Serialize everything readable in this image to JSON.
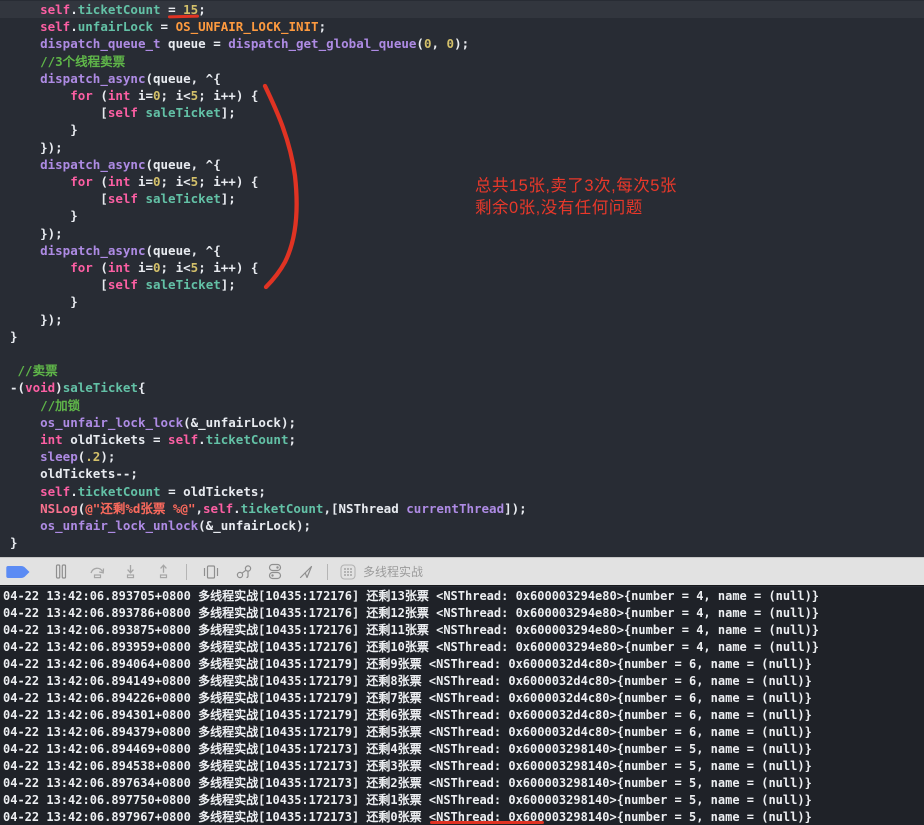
{
  "editor": {
    "background": "#282c34",
    "highlight_line": 0,
    "lines": [
      {
        "hl": true,
        "tokens": [
          [
            "p",
            "    "
          ],
          [
            "k",
            "self"
          ],
          [
            "p",
            "."
          ],
          [
            "t",
            "ticketCount"
          ],
          [
            "p",
            " = "
          ],
          [
            "n",
            "15"
          ],
          [
            "p",
            ";"
          ]
        ]
      },
      {
        "tokens": [
          [
            "p",
            "    "
          ],
          [
            "k",
            "self"
          ],
          [
            "p",
            "."
          ],
          [
            "t",
            "unfairLock"
          ],
          [
            "p",
            " = "
          ],
          [
            "m",
            "OS_UNFAIR_LOCK_INIT"
          ],
          [
            "p",
            ";"
          ]
        ]
      },
      {
        "tokens": [
          [
            "p",
            "    "
          ],
          [
            "f",
            "dispatch_queue_t"
          ],
          [
            "p",
            " queue = "
          ],
          [
            "f",
            "dispatch_get_global_queue"
          ],
          [
            "p",
            "("
          ],
          [
            "n",
            "0"
          ],
          [
            "p",
            ", "
          ],
          [
            "n",
            "0"
          ],
          [
            "p",
            ");"
          ]
        ]
      },
      {
        "tokens": [
          [
            "p",
            "    "
          ],
          [
            "c",
            "//3个线程卖票"
          ]
        ]
      },
      {
        "tokens": [
          [
            "p",
            "    "
          ],
          [
            "f",
            "dispatch_async"
          ],
          [
            "p",
            "(queue, ^{"
          ]
        ]
      },
      {
        "tokens": [
          [
            "p",
            "        "
          ],
          [
            "k",
            "for"
          ],
          [
            "p",
            " ("
          ],
          [
            "k",
            "int"
          ],
          [
            "p",
            " i="
          ],
          [
            "n",
            "0"
          ],
          [
            "p",
            "; i<"
          ],
          [
            "n",
            "5"
          ],
          [
            "p",
            "; i++) {"
          ]
        ]
      },
      {
        "tokens": [
          [
            "p",
            "            ["
          ],
          [
            "k",
            "self"
          ],
          [
            "p",
            " "
          ],
          [
            "t",
            "saleTicket"
          ],
          [
            "p",
            "];"
          ]
        ]
      },
      {
        "tokens": [
          [
            "p",
            "        }"
          ]
        ]
      },
      {
        "tokens": [
          [
            "p",
            "    });"
          ]
        ]
      },
      {
        "tokens": [
          [
            "p",
            "    "
          ],
          [
            "f",
            "dispatch_async"
          ],
          [
            "p",
            "(queue, ^{"
          ]
        ]
      },
      {
        "tokens": [
          [
            "p",
            "        "
          ],
          [
            "k",
            "for"
          ],
          [
            "p",
            " ("
          ],
          [
            "k",
            "int"
          ],
          [
            "p",
            " i="
          ],
          [
            "n",
            "0"
          ],
          [
            "p",
            "; i<"
          ],
          [
            "n",
            "5"
          ],
          [
            "p",
            "; i++) {"
          ]
        ]
      },
      {
        "tokens": [
          [
            "p",
            "            ["
          ],
          [
            "k",
            "self"
          ],
          [
            "p",
            " "
          ],
          [
            "t",
            "saleTicket"
          ],
          [
            "p",
            "];"
          ]
        ]
      },
      {
        "tokens": [
          [
            "p",
            "        }"
          ]
        ]
      },
      {
        "tokens": [
          [
            "p",
            "    });"
          ]
        ]
      },
      {
        "tokens": [
          [
            "p",
            "    "
          ],
          [
            "f",
            "dispatch_async"
          ],
          [
            "p",
            "(queue, ^{"
          ]
        ]
      },
      {
        "tokens": [
          [
            "p",
            "        "
          ],
          [
            "k",
            "for"
          ],
          [
            "p",
            " ("
          ],
          [
            "k",
            "int"
          ],
          [
            "p",
            " i="
          ],
          [
            "n",
            "0"
          ],
          [
            "p",
            "; i<"
          ],
          [
            "n",
            "5"
          ],
          [
            "p",
            "; i++) {"
          ]
        ]
      },
      {
        "tokens": [
          [
            "p",
            "            ["
          ],
          [
            "k",
            "self"
          ],
          [
            "p",
            " "
          ],
          [
            "t",
            "saleTicket"
          ],
          [
            "p",
            "];"
          ]
        ]
      },
      {
        "tokens": [
          [
            "p",
            "        }"
          ]
        ]
      },
      {
        "tokens": [
          [
            "p",
            "    });"
          ]
        ]
      },
      {
        "tokens": [
          [
            "p",
            "}"
          ]
        ]
      },
      {
        "tokens": []
      },
      {
        "tokens": [
          [
            "p",
            " "
          ],
          [
            "c",
            "//卖票"
          ]
        ]
      },
      {
        "tokens": [
          [
            "p",
            "-("
          ],
          [
            "k",
            "void"
          ],
          [
            "p",
            ")"
          ],
          [
            "t",
            "saleTicket"
          ],
          [
            "p",
            "{"
          ]
        ]
      },
      {
        "tokens": [
          [
            "p",
            "    "
          ],
          [
            "c",
            "//加锁"
          ]
        ]
      },
      {
        "tokens": [
          [
            "p",
            "    "
          ],
          [
            "f",
            "os_unfair_lock_lock"
          ],
          [
            "p",
            "(&_unfairLock);"
          ]
        ]
      },
      {
        "tokens": [
          [
            "p",
            "    "
          ],
          [
            "k",
            "int"
          ],
          [
            "p",
            " oldTickets = "
          ],
          [
            "k",
            "self"
          ],
          [
            "p",
            "."
          ],
          [
            "t",
            "ticketCount"
          ],
          [
            "p",
            ";"
          ]
        ]
      },
      {
        "tokens": [
          [
            "p",
            "    "
          ],
          [
            "f",
            "sleep"
          ],
          [
            "p",
            "("
          ],
          [
            "n",
            ".2"
          ],
          [
            "p",
            ");"
          ]
        ]
      },
      {
        "tokens": [
          [
            "p",
            "    oldTickets--;"
          ]
        ]
      },
      {
        "tokens": [
          [
            "p",
            "    "
          ],
          [
            "k",
            "self"
          ],
          [
            "p",
            "."
          ],
          [
            "t",
            "ticketCount"
          ],
          [
            "p",
            " = oldTickets;"
          ]
        ]
      },
      {
        "tokens": [
          [
            "p",
            "    "
          ],
          [
            "g",
            "NSLog"
          ],
          [
            "p",
            "("
          ],
          [
            "s",
            "@\"还剩%d张票 %@\""
          ],
          [
            "p",
            ","
          ],
          [
            "k",
            "self"
          ],
          [
            "p",
            "."
          ],
          [
            "t",
            "ticketCount"
          ],
          [
            "p",
            ",[NSThread "
          ],
          [
            "f",
            "currentThread"
          ],
          [
            "p",
            "]);"
          ]
        ]
      },
      {
        "tokens": [
          [
            "p",
            "    "
          ],
          [
            "f",
            "os_unfair_lock_unlock"
          ],
          [
            "p",
            "(&_unfairLock);"
          ]
        ]
      },
      {
        "tokens": [
          [
            "p",
            "}"
          ]
        ]
      }
    ]
  },
  "annotation": {
    "line1": "总共15张,卖了3次,每次5张",
    "line2": "剩余0张,没有任何问题",
    "color": "#e8382a",
    "underlined_code_value": "15",
    "underlined_console_text": "还剩0张票"
  },
  "debug_bar": {
    "scheme_label": "多线程实战",
    "accent_blue": "#5b8bf4",
    "icon_names": [
      "breakpoint-arrow",
      "pause",
      "step-over",
      "step-into",
      "step-out",
      "view-debugger",
      "memory-graph",
      "environment-overrides",
      "simulate-location",
      "app-grid"
    ]
  },
  "console": {
    "background": "#1f2228",
    "lines": [
      "04-22 13:42:06.893705+0800 多线程实战[10435:172176] 还剩13张票 <NSThread: 0x600003294e80>{number = 4, name = (null)}",
      "04-22 13:42:06.893786+0800 多线程实战[10435:172176] 还剩12张票 <NSThread: 0x600003294e80>{number = 4, name = (null)}",
      "04-22 13:42:06.893875+0800 多线程实战[10435:172176] 还剩11张票 <NSThread: 0x600003294e80>{number = 4, name = (null)}",
      "04-22 13:42:06.893959+0800 多线程实战[10435:172176] 还剩10张票 <NSThread: 0x600003294e80>{number = 4, name = (null)}",
      "04-22 13:42:06.894064+0800 多线程实战[10435:172179] 还剩9张票 <NSThread: 0x6000032d4c80>{number = 6, name = (null)}",
      "04-22 13:42:06.894149+0800 多线程实战[10435:172179] 还剩8张票 <NSThread: 0x6000032d4c80>{number = 6, name = (null)}",
      "04-22 13:42:06.894226+0800 多线程实战[10435:172179] 还剩7张票 <NSThread: 0x6000032d4c80>{number = 6, name = (null)}",
      "04-22 13:42:06.894301+0800 多线程实战[10435:172179] 还剩6张票 <NSThread: 0x6000032d4c80>{number = 6, name = (null)}",
      "04-22 13:42:06.894379+0800 多线程实战[10435:172179] 还剩5张票 <NSThread: 0x6000032d4c80>{number = 6, name = (null)}",
      "04-22 13:42:06.894469+0800 多线程实战[10435:172173] 还剩4张票 <NSThread: 0x600003298140>{number = 5, name = (null)}",
      "04-22 13:42:06.894538+0800 多线程实战[10435:172173] 还剩3张票 <NSThread: 0x600003298140>{number = 5, name = (null)}",
      "04-22 13:42:06.897634+0800 多线程实战[10435:172173] 还剩2张票 <NSThread: 0x600003298140>{number = 5, name = (null)}",
      "04-22 13:42:06.897750+0800 多线程实战[10435:172173] 还剩1张票 <NSThread: 0x600003298140>{number = 5, name = (null)}",
      "04-22 13:42:06.897967+0800 多线程实战[10435:172173] 还剩0张票 <NSThread: 0x600003298140>{number = 5, name = (null)}"
    ]
  }
}
